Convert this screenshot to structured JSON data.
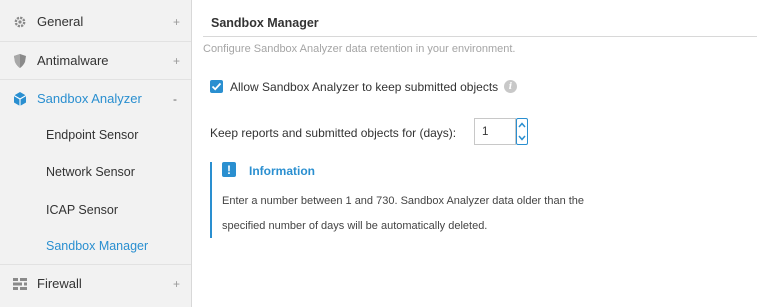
{
  "sidebar": {
    "items": [
      {
        "label": "General",
        "icon": "gear-icon",
        "expander": "+"
      },
      {
        "label": "Antimalware",
        "icon": "shield-icon",
        "expander": "+"
      },
      {
        "label": "Sandbox Analyzer",
        "icon": "cube-icon",
        "expander": "-",
        "children": [
          {
            "label": "Endpoint Sensor"
          },
          {
            "label": "Network Sensor"
          },
          {
            "label": "ICAP Sensor"
          },
          {
            "label": "Sandbox Manager"
          }
        ]
      },
      {
        "label": "Firewall",
        "icon": "firewall-icon",
        "expander": "+"
      }
    ],
    "selected": "Sandbox Manager"
  },
  "main": {
    "title": "Sandbox Manager",
    "subtitle": "Configure Sandbox Analyzer data retention in your environment.",
    "allow_checkbox": {
      "label": "Allow Sandbox Analyzer to keep submitted objects",
      "checked": true
    },
    "keep": {
      "label": "Keep reports and submitted objects for (days):",
      "value": "1"
    },
    "info": {
      "title": "Information",
      "line1": "Enter a number between 1 and 730. Sandbox Analyzer data older than the",
      "line2": "specified number of days will be automatically deleted."
    }
  },
  "colors": {
    "accent": "#2a8fd0",
    "sidebar_bg": "#f2f2f2"
  }
}
